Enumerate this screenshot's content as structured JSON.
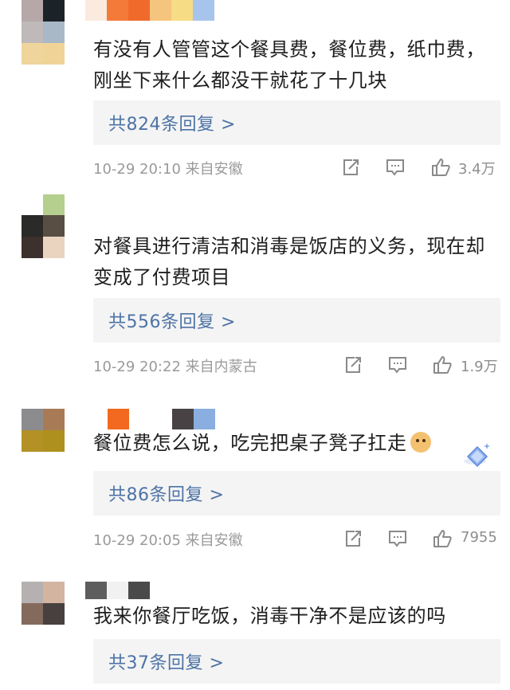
{
  "comments": [
    {
      "text": "有没有人管管这个餐具费，餐位费，纸巾费，刚坐下来什么都没干就花了十几块",
      "replies": "共824条回复 >",
      "time": "10-29 20:10",
      "location": "来自安徽",
      "likes": "3.4万",
      "avatar_colors": [
        "#b6a8a8",
        "#1c2328",
        "#bfb9b9",
        "#a9b8c6",
        "#efd49b",
        "#f0d497"
      ],
      "name_colors": [
        "#fbeade",
        "#f47a3a",
        "#f06a2c",
        "#f5c47d",
        "#f5dc85",
        "#a7c4ec"
      ]
    },
    {
      "text": "对餐具进行清洁和消毒是饭店的义务，现在却变成了付费项目",
      "replies": "共556条回复 >",
      "time": "10-29 20:22",
      "location": "来自内蒙古",
      "likes": "1.9万",
      "avatar_colors": [
        "#ffffff",
        "#b4cf8e",
        "#2a2a28",
        "#594e44",
        "#3d312d",
        "#ead4c0"
      ]
    },
    {
      "text": "餐位费怎么说，吃完把桌子凳子扛走",
      "replies": "共86条回复 >",
      "time": "10-29 20:05",
      "location": "来自安徽",
      "likes": "7955",
      "avatar_colors": [
        "#8c8c8e",
        "#a97a56",
        "#b39124",
        "#ae901f"
      ],
      "name_colors": [
        "#f3691f",
        "#494244",
        "#8aaedf"
      ]
    },
    {
      "text": "我来你餐厅吃饭，消毒干净不是应该的吗",
      "replies": "共37条回复 >",
      "avatar_colors": [
        "#b5b1b0",
        "#d3b4a1",
        "#846a5d",
        "#47403e"
      ],
      "name_colors": [
        "#5d5d5d",
        "#f1f1f1",
        "#4a4a4a"
      ]
    }
  ],
  "icons": {
    "share": "share-icon",
    "comment": "comment-icon",
    "like": "like-icon",
    "doge_emoji": "doge-emoji-icon",
    "gem": "gem-badge-icon"
  },
  "colors": {
    "reply_link": "#4d73a6",
    "reply_bg": "#f4f4f4",
    "meta_text": "#9a9a9a"
  }
}
